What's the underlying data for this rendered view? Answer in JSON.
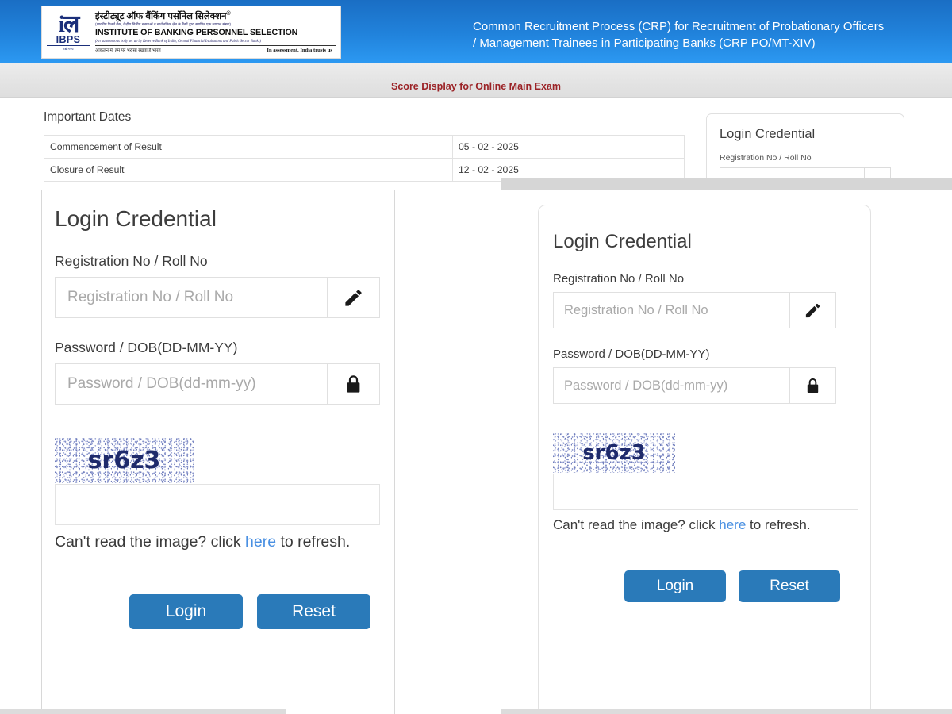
{
  "header": {
    "title": "Common Recruitment Process (CRP) for Recruitment of Probationary Officers / Management Trainees in Participating Banks (CRP PO/MT-XIV)",
    "logo": {
      "mark_glyph": "iल",
      "abbr": "IBPS",
      "abbr_sub": "उद्योगस्य",
      "hindi_title": "इंस्टीट्यूट ऑफ बैंकिंग पर्सोनेल सिलेक्शन",
      "hindi_registered": "®",
      "hindi_subtitle": "(भारतीय रिजर्व बैंक, केंद्रीय वित्तीय संस्थाओं व सार्वजनिक क्षेत्र के बैंकों द्वारा स्थापित एक स्वायत्त संस्था)",
      "english_title": "INSTITUTE OF BANKING PERSONNEL SELECTION",
      "english_subtitle": "(An autonomous body set up by Reserve Bank of India, Central Financial Institutions and Public Sector Banks)",
      "tagline_hindi": "आकलन में, हम पर भरोसा रखता है भारत",
      "tagline_english": "In assessment, India trusts us"
    }
  },
  "notice": {
    "text": "Score Display for Online Main Exam"
  },
  "important_dates": {
    "title": "Important Dates",
    "rows": [
      {
        "label": "Commencement of Result",
        "value": "05 - 02 - 2025"
      },
      {
        "label": "Closure of Result",
        "value": "12 - 02 - 2025"
      }
    ]
  },
  "login_panel": {
    "title": "Login Credential",
    "registration_label": "Registration No / Roll No",
    "registration_placeholder": "Registration No / Roll No",
    "registration_value": "",
    "registration_icon": "pencil-icon",
    "password_label": "Password / DOB(DD-MM-YY)",
    "password_placeholder": "Password / DOB(dd-mm-yy)",
    "password_value": "",
    "password_icon": "lock-icon",
    "captcha_text": "sr6z3",
    "captcha_input_value": "",
    "captcha_hint_prefix": "Can't read the image? click ",
    "captcha_hint_link": "here",
    "captcha_hint_suffix": " to refresh.",
    "login_button": "Login",
    "reset_button": "Reset"
  },
  "colors": {
    "header_top": "#1a6ec4",
    "header_bottom": "#2c99f2",
    "notice_text": "#9b2226",
    "button_blue": "#2a7ab9",
    "link_blue": "#4a90e2",
    "captcha_ink": "#1e2a6b"
  }
}
